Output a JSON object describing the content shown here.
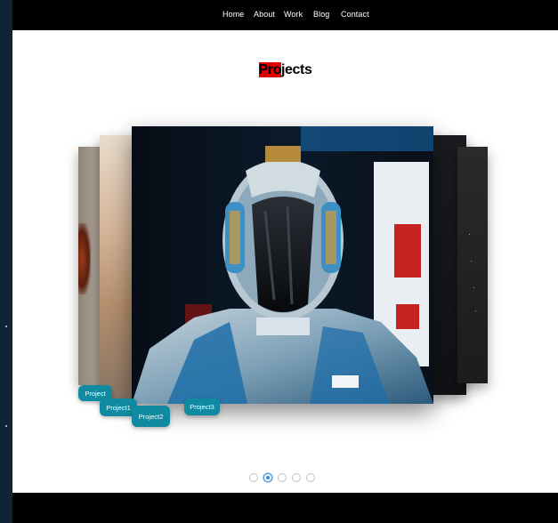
{
  "nav": {
    "items": [
      {
        "label": "Home"
      },
      {
        "label": "About"
      },
      {
        "label": "Work"
      },
      {
        "label": "Blog"
      },
      {
        "label": "Contact"
      }
    ]
  },
  "section": {
    "title_highlight": "Pro",
    "title_rest": "jects"
  },
  "carousel": {
    "labels": [
      "Project",
      "Project1",
      "Project2",
      "Project3"
    ],
    "active_slide": 2,
    "slide_count": 5
  },
  "colors": {
    "accent": "#0f8aa0",
    "highlight": "#e00000",
    "nav_bg": "#000000"
  }
}
